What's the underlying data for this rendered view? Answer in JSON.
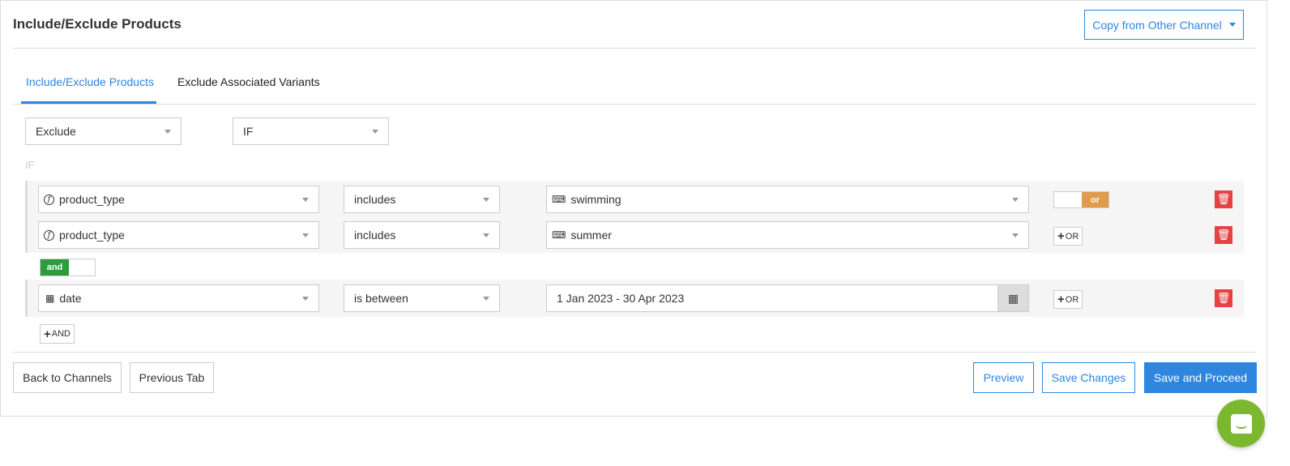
{
  "header": {
    "title": "Include/Exclude Products",
    "copy_button": "Copy from Other Channel"
  },
  "tabs": [
    {
      "label": "Include/Exclude Products",
      "active": true
    },
    {
      "label": "Exclude Associated Variants",
      "active": false
    }
  ],
  "filters": {
    "mode": "Exclude",
    "condition": "IF"
  },
  "if_label": "IF",
  "groups": [
    {
      "rows": [
        {
          "field": "product_type",
          "field_icon": "function-icon",
          "operator": "includes",
          "value": "swimming",
          "value_icon": "keyboard-icon",
          "connector": "or"
        },
        {
          "field": "product_type",
          "field_icon": "function-icon",
          "operator": "includes",
          "value": "summer",
          "value_icon": "keyboard-icon",
          "add_or": "OR"
        }
      ]
    },
    {
      "rows": [
        {
          "field": "date",
          "field_icon": "calendar-icon",
          "operator": "is between",
          "value": "1 Jan 2023 - 30 Apr 2023",
          "add_or": "OR"
        }
      ]
    }
  ],
  "group_connector": "and",
  "add_and": "AND",
  "footer": {
    "back": "Back to Channels",
    "previous": "Previous Tab",
    "preview": "Preview",
    "save_changes": "Save Changes",
    "save_proceed": "Save and Proceed"
  },
  "colors": {
    "accent": "#2e86de",
    "or_toggle": "#e09b4b",
    "and_toggle": "#2e9b3e",
    "delete": "#e54343",
    "chat": "#7cb82f"
  }
}
